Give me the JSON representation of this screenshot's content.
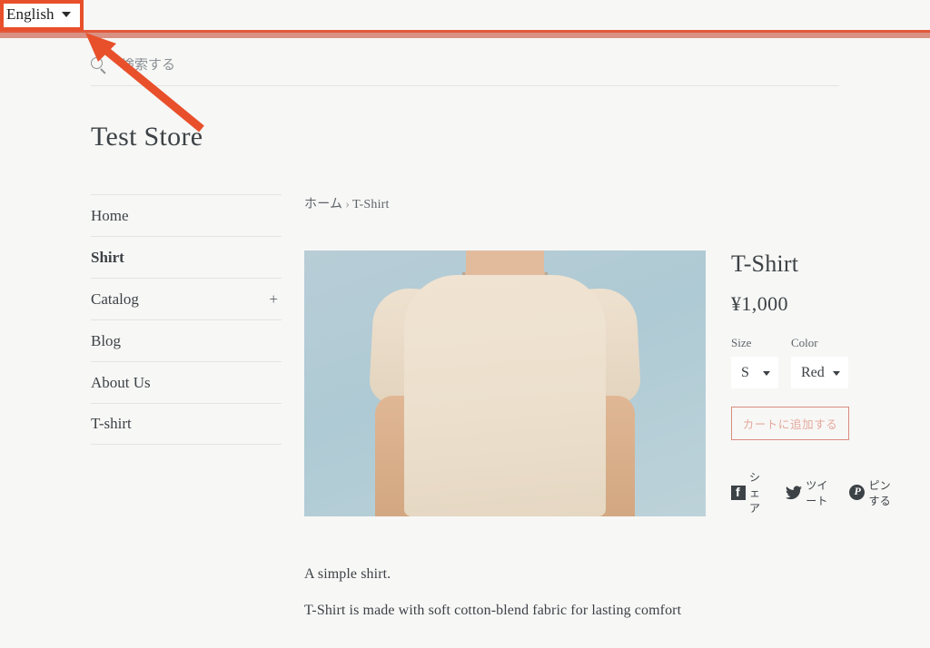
{
  "browser": {
    "language_selector": {
      "value": "English",
      "caret_icon": "chevron-down-icon"
    }
  },
  "search": {
    "icon": "search-icon",
    "placeholder": "検索する",
    "value": ""
  },
  "store": {
    "title": "Test Store"
  },
  "sidebar": {
    "items": [
      {
        "label": "Home",
        "active": false,
        "expander": ""
      },
      {
        "label": "Shirt",
        "active": true,
        "expander": ""
      },
      {
        "label": "Catalog",
        "active": false,
        "expander": "+"
      },
      {
        "label": "Blog",
        "active": false,
        "expander": ""
      },
      {
        "label": "About Us",
        "active": false,
        "expander": ""
      },
      {
        "label": "T-shirt",
        "active": false,
        "expander": ""
      }
    ]
  },
  "breadcrumb": {
    "home": "ホーム",
    "separator": "›",
    "current": "T-Shirt"
  },
  "product": {
    "image_alt": "person wearing cream t-shirt on light blue background",
    "title": "T-Shirt",
    "price": "¥1,000",
    "options": [
      {
        "label": "Size",
        "value": "S",
        "caret_icon": "chevron-down-icon"
      },
      {
        "label": "Color",
        "value": "Red",
        "caret_icon": "chevron-down-icon"
      }
    ],
    "add_to_cart_label": "カートに追加する",
    "share": [
      {
        "icon": "facebook-icon",
        "label": "シェア"
      },
      {
        "icon": "twitter-icon",
        "label": "ツイート"
      },
      {
        "icon": "pinterest-icon",
        "label": "ピンする"
      }
    ],
    "description": [
      "A simple shirt.",
      "T-Shirt is made with soft cotton-blend fabric for lasting comfort"
    ]
  },
  "annotation": {
    "highlight_color": "#e8502b",
    "arrow_color": "#e8502b",
    "target": "language-selector"
  },
  "colors": {
    "page_background": "#f7f7f6",
    "text": "#3d4246",
    "muted_text": "#5e6368",
    "divider": "#e4e4e2",
    "accent_bar_dark": "#e2593c",
    "accent_bar_light": "#d89182",
    "cart_border": "#d98d7e",
    "cart_text": "#e5a99c"
  }
}
